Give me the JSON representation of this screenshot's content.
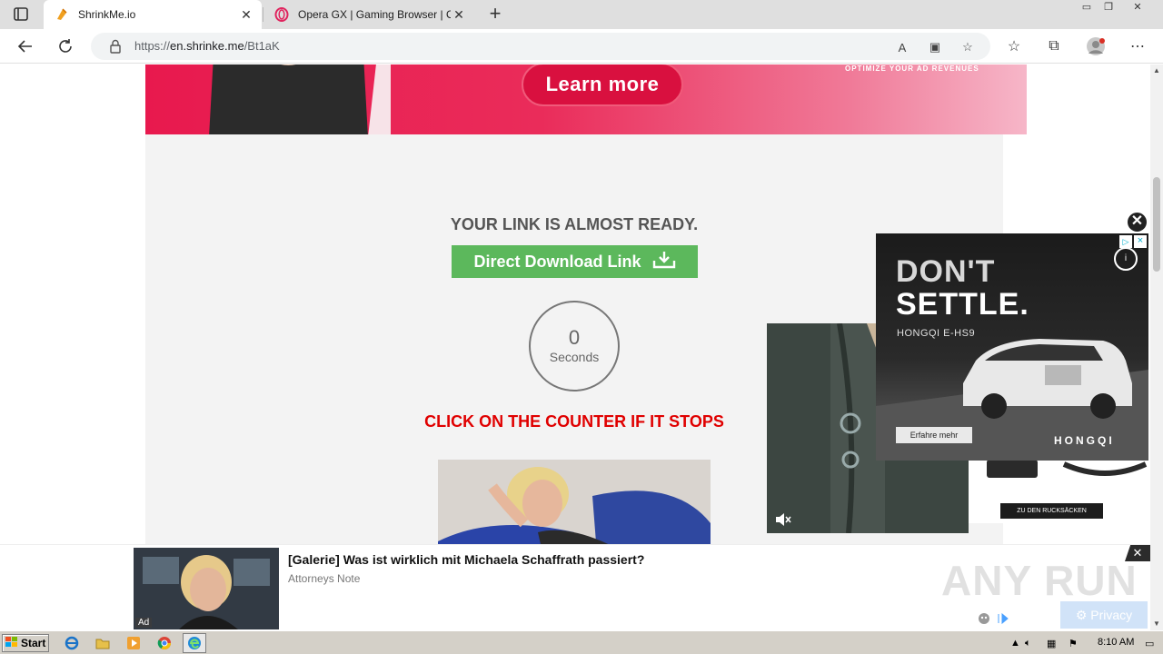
{
  "browser": {
    "tabs": [
      {
        "title": "ShrinkMe.io",
        "active": true
      },
      {
        "title": "Opera GX | Gaming Browser | Op",
        "active": false
      }
    ],
    "url_scheme": "https://",
    "url_host": "en.shrinke.me",
    "url_path": "/Bt1aK"
  },
  "banner": {
    "button_label": "Learn more",
    "tagline": "OPTIMIZE   YOUR AD REVENUES"
  },
  "main": {
    "heading": "YOUR LINK IS ALMOST READY.",
    "download_button": "Direct Download Link",
    "counter_value": "0",
    "counter_unit": "Seconds",
    "instruction": "CLICK ON THE COUNTER IF IT STOPS",
    "ad_label": "Ad"
  },
  "car_ad": {
    "headline_line1": "DON'T",
    "headline_line2": "SETTLE.",
    "model": "HONGQI E-HS9",
    "cta": "Erfahre mehr",
    "brand": "HONGQI",
    "info": "i"
  },
  "side_ad": {
    "button_label": "ZU DEN RUCKSÄCKEN"
  },
  "bottom_ad": {
    "title": "[Galerie] Was ist wirklich mit Michaela Schaffrath passiert?",
    "source": "Attorneys Note",
    "ad_label": "Ad",
    "privacy": "Privacy",
    "watermark": "ANY RUN"
  },
  "taskbar": {
    "start_label": "Start",
    "clock": "8:10 AM"
  },
  "colors": {
    "download_green": "#5cb85c",
    "warning_red": "#e00000",
    "banner_pink": "#e8194e"
  }
}
